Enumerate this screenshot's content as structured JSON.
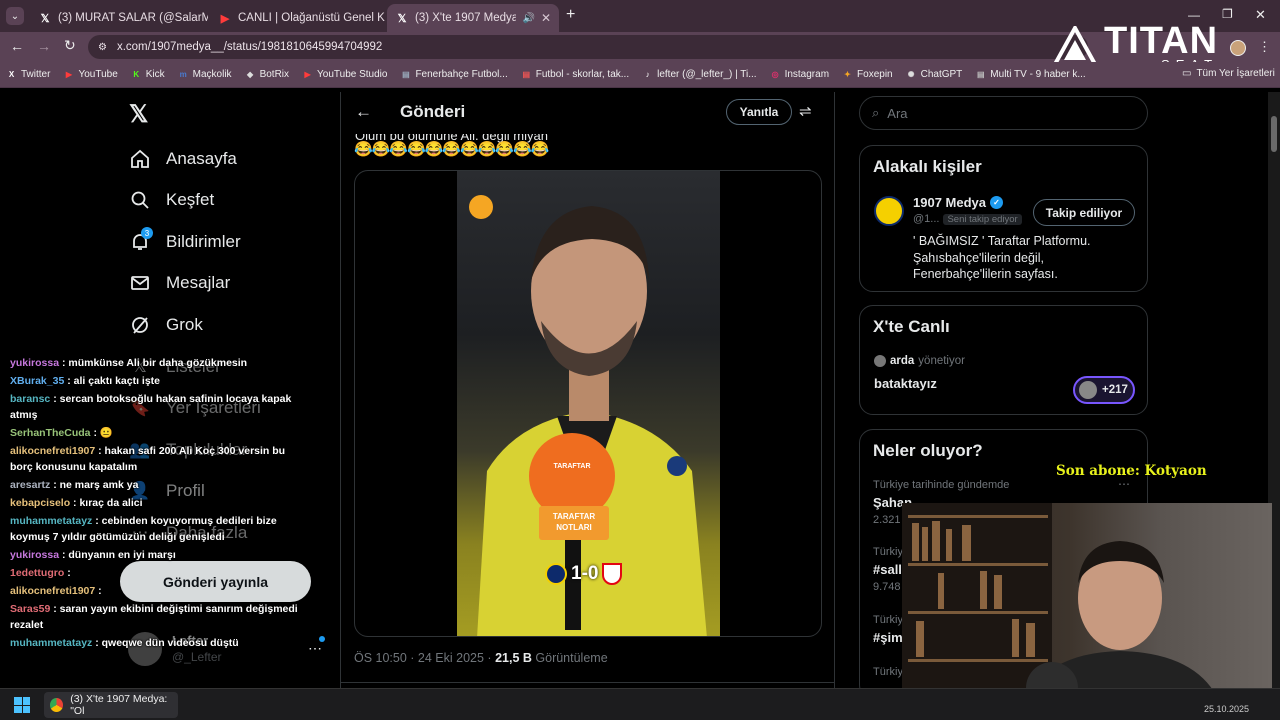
{
  "tabs": [
    {
      "title": "(3) MURAT SALAR (@SalarMura",
      "fav": "X",
      "favcolor": "#fff"
    },
    {
      "title": "CANLI | Olağanüstü Genel K",
      "fav": "▶",
      "favcolor": "#ff3b3b"
    },
    {
      "title": "(3) X'te 1907 Medya: \"Olum",
      "fav": "X",
      "favcolor": "#fff"
    }
  ],
  "address": "x.com/1907medya__/status/1981810645994704992",
  "bookmarks": [
    {
      "label": "Twitter",
      "icon": "X",
      "color": "#fff"
    },
    {
      "label": "YouTube",
      "icon": "▶",
      "color": "#ff3b3b"
    },
    {
      "label": "Kick",
      "icon": "K",
      "color": "#53fc18"
    },
    {
      "label": "Maçkolik",
      "icon": "m",
      "color": "#4a7bd0"
    },
    {
      "label": "BotRix",
      "icon": "◆",
      "color": "#ddd"
    },
    {
      "label": "YouTube Studio",
      "icon": "▶",
      "color": "#ff3b3b"
    },
    {
      "label": "Fenerbahçe Futbol...",
      "icon": "▤",
      "color": "#9ab"
    },
    {
      "label": "Futbol - skorlar, tak...",
      "icon": "▤",
      "color": "#e55"
    },
    {
      "label": "lefter (@_lefter_) | Ti...",
      "icon": "♪",
      "color": "#fff"
    },
    {
      "label": "Instagram",
      "icon": "◎",
      "color": "#e1306c"
    },
    {
      "label": "Foxepin",
      "icon": "✦",
      "color": "#f5a623"
    },
    {
      "label": "ChatGPT",
      "icon": "✺",
      "color": "#ddd"
    },
    {
      "label": "Multi TV - 9 haber k...",
      "icon": "▤",
      "color": "#bbb"
    }
  ],
  "all_bookmarks": "Tüm Yer İşaretleri",
  "brand": {
    "name": "TITAN",
    "sub": "SEAT"
  },
  "nav": {
    "home": "Anasayfa",
    "explore": "Keşfet",
    "notifications": "Bildirimler",
    "notif_count": "3",
    "messages": "Mesajlar",
    "grok": "Grok",
    "lists": "Listeler",
    "bookmarks": "Yer İşaretleri",
    "communities": "Topluluklar",
    "profile": "Profil",
    "more": "Daha fazla",
    "post_button": "Gönderi yayınla",
    "account_name": "Lefter",
    "account_handle": "@_Lefter"
  },
  "post": {
    "header": "Gönderi",
    "reply_button": "Yanıtla",
    "text_partial": "Olum bu ölümüne Ali. değil miyah",
    "emojis": "😂😂😂😂😂😂😂😂😂😂😂",
    "mic_brand": "TARAFTAR",
    "mic_sub": "NOTLARI",
    "score": "1-0",
    "timestamp": "ÖS 10:50 · 24 Eki 2025 · ",
    "views": "21,5 B",
    "views_label": "Görüntüleme"
  },
  "search": {
    "placeholder": "Ara"
  },
  "related": {
    "title": "Alakalı kişiler",
    "name": "1907 Medya",
    "handle": "@1...",
    "follows_you": "Seni takip ediyor",
    "follow_button": "Takip ediliyor",
    "bio_1": "' BAĞIMSIZ ' Taraftar Platformu.",
    "bio_2": "Şahısbahçe'lilerin değil,",
    "bio_3": "Fenerbahçe'lilerin sayfası."
  },
  "live": {
    "title": "X'te Canlı",
    "host": "arda",
    "hosting": "yönetiyor",
    "space": "bataktayız",
    "listeners": "+217"
  },
  "trends": {
    "title": "Neler oluyor?",
    "t1_context": "Türkiye tarihinde gündemde",
    "t1_name": "Şahan",
    "t1_count": "2.321",
    "t2_context": "Türkiy",
    "t2_name": "#sall",
    "t2_count": "9.748",
    "t3_context": "Türkiy",
    "t3_name": "#şim",
    "t4_context": "Türkiy"
  },
  "stream": {
    "last_sub": "Son abone: Kotyaon"
  },
  "chat": [
    {
      "user": "yukirossa",
      "color": "#c678dd",
      "msg": ": mümkünse Ali bir daha gözükmesin"
    },
    {
      "user": "XBurak_35",
      "color": "#61afef",
      "msg": ": ali çaktı kaçtı işte"
    },
    {
      "user": "baransc",
      "color": "#56b6c2",
      "msg": ": sercan botoksoğlu hakan safinin locaya kapak atmış"
    },
    {
      "user": "SerhanTheCuda",
      "color": "#98c379",
      "msg": ": 😐"
    },
    {
      "user": "alikocnefreti1907",
      "color": "#e5c07b",
      "msg": ": hakan safi 200 Ali Koç 300 versin bu borç konusunu kapatalım"
    },
    {
      "user": "aresartz",
      "color": "#abb2bf",
      "msg": ": ne marş amk ya"
    },
    {
      "user": "kebapciselo",
      "color": "#e5c07b",
      "msg": ": kıraç da alici"
    },
    {
      "user": "muhammetatayz",
      "color": "#56b6c2",
      "msg": ": cebinden koyuyormuş dedileri bize koymuş 7 yıldır götümüzün deliği genişledi"
    },
    {
      "user": "yukirossa",
      "color": "#c678dd",
      "msg": ": dünyanın en iyi marşı"
    },
    {
      "user": "1edettugro",
      "color": "#e06c75",
      "msg": ":"
    },
    {
      "user": "alikocnefreti1907",
      "color": "#e5c07b",
      "msg": ":"
    },
    {
      "user": "Saras59",
      "color": "#e06c75",
      "msg": ": saran yayın ekibini değiştimi sanırım değişmedi rezalet"
    },
    {
      "user": "muhammetatayz",
      "color": "#56b6c2",
      "msg": ": qweqwe dün videosu düştü"
    }
  ],
  "taskbar": {
    "window": "(3) X'te 1907 Medya: \"Ol",
    "date": "25.10.2025"
  }
}
